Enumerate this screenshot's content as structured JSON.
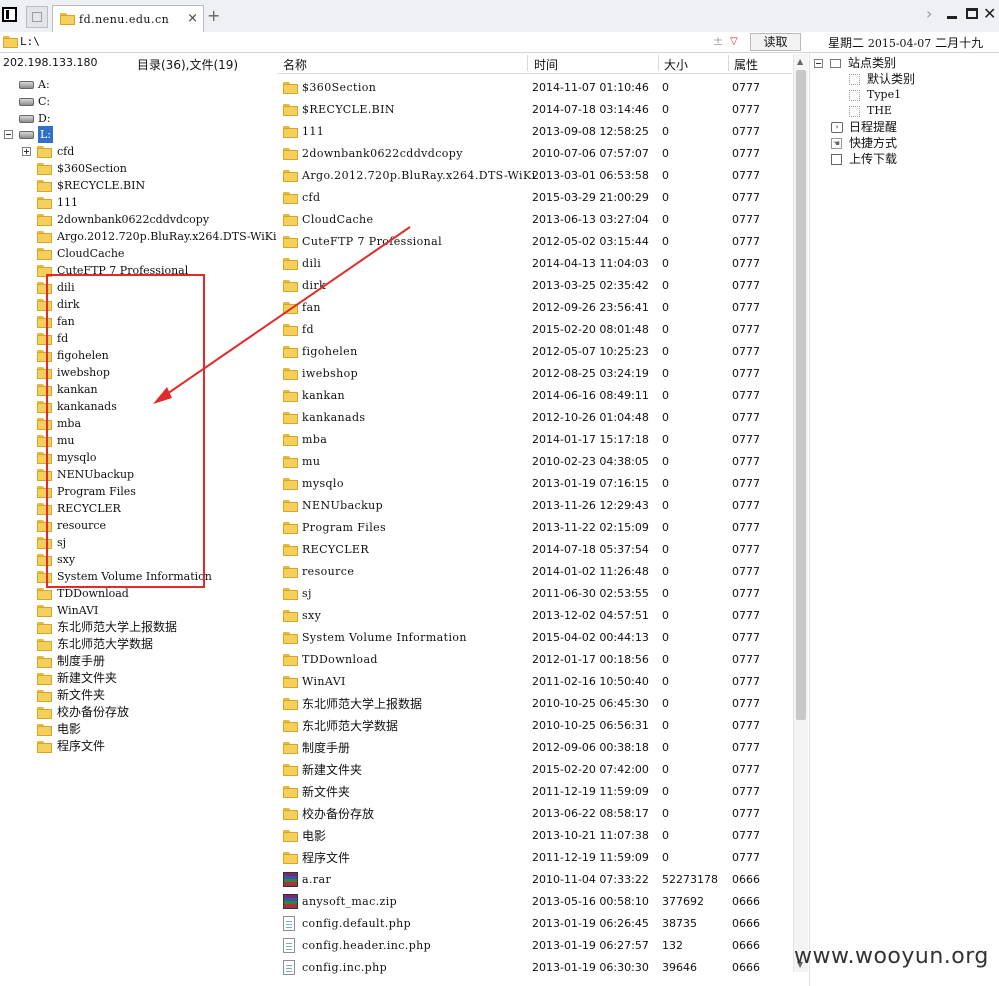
{
  "tab": {
    "title": "fd.nenu.edu.cn"
  },
  "address": {
    "path": "L:\\",
    "read_label": "读取"
  },
  "datebar": {
    "weekday": "星期二",
    "date": "2015-04-07",
    "lunar": "二月十九"
  },
  "left": {
    "ip": "202.198.133.180",
    "count": "目录(36),文件(19)",
    "drives": [
      "A:",
      "C:",
      "D:",
      "L:"
    ],
    "folders": [
      "cfd",
      "$360Section",
      "$RECYCLE.BIN",
      "111",
      "2downbank0622cddvdcopy",
      "Argo.2012.720p.BluRay.x264.DTS-WiKi",
      "CloudCache",
      "CuteFTP 7 Professional",
      "dili",
      "dirk",
      "fan",
      "fd",
      "figohelen",
      "iwebshop",
      "kankan",
      "kankanads",
      "mba",
      "mu",
      "mysqlo",
      "NENUbackup",
      "Program Files",
      "RECYCLER",
      "resource",
      "sj",
      "sxy",
      "System Volume Information",
      "TDDownload",
      "WinAVI",
      "东北师范大学上报数据",
      "东北师范大学数据",
      "制度手册",
      "新建文件夹",
      "新文件夹",
      "校办备份存放",
      "电影",
      "程序文件"
    ]
  },
  "list": {
    "headers": {
      "name": "名称",
      "time": "时间",
      "size": "大小",
      "attr": "属性"
    },
    "rows": [
      {
        "name": "$360Section",
        "time": "2014-11-07 01:10:46",
        "size": "0",
        "attr": "0777",
        "type": "folder"
      },
      {
        "name": "$RECYCLE.BIN",
        "time": "2014-07-18 03:14:46",
        "size": "0",
        "attr": "0777",
        "type": "folder"
      },
      {
        "name": "111",
        "time": "2013-09-08 12:58:25",
        "size": "0",
        "attr": "0777",
        "type": "folder"
      },
      {
        "name": "2downbank0622cddvdcopy",
        "time": "2010-07-06 07:57:07",
        "size": "0",
        "attr": "0777",
        "type": "folder"
      },
      {
        "name": "Argo.2012.720p.BluRay.x264.DTS-WiKi",
        "time": "2013-03-01 06:53:58",
        "size": "0",
        "attr": "0777",
        "type": "folder"
      },
      {
        "name": "cfd",
        "time": "2015-03-29 21:00:29",
        "size": "0",
        "attr": "0777",
        "type": "folder"
      },
      {
        "name": "CloudCache",
        "time": "2013-06-13 03:27:04",
        "size": "0",
        "attr": "0777",
        "type": "folder"
      },
      {
        "name": "CuteFTP 7 Professional",
        "time": "2012-05-02 03:15:44",
        "size": "0",
        "attr": "0777",
        "type": "folder"
      },
      {
        "name": "dili",
        "time": "2014-04-13 11:04:03",
        "size": "0",
        "attr": "0777",
        "type": "folder"
      },
      {
        "name": "dirk",
        "time": "2013-03-25 02:35:42",
        "size": "0",
        "attr": "0777",
        "type": "folder"
      },
      {
        "name": "fan",
        "time": "2012-09-26 23:56:41",
        "size": "0",
        "attr": "0777",
        "type": "folder"
      },
      {
        "name": "fd",
        "time": "2015-02-20 08:01:48",
        "size": "0",
        "attr": "0777",
        "type": "folder"
      },
      {
        "name": "figohelen",
        "time": "2012-05-07 10:25:23",
        "size": "0",
        "attr": "0777",
        "type": "folder"
      },
      {
        "name": "iwebshop",
        "time": "2012-08-25 03:24:19",
        "size": "0",
        "attr": "0777",
        "type": "folder"
      },
      {
        "name": "kankan",
        "time": "2014-06-16 08:49:11",
        "size": "0",
        "attr": "0777",
        "type": "folder"
      },
      {
        "name": "kankanads",
        "time": "2012-10-26 01:04:48",
        "size": "0",
        "attr": "0777",
        "type": "folder"
      },
      {
        "name": "mba",
        "time": "2014-01-17 15:17:18",
        "size": "0",
        "attr": "0777",
        "type": "folder"
      },
      {
        "name": "mu",
        "time": "2010-02-23 04:38:05",
        "size": "0",
        "attr": "0777",
        "type": "folder"
      },
      {
        "name": "mysqlo",
        "time": "2013-01-19 07:16:15",
        "size": "0",
        "attr": "0777",
        "type": "folder"
      },
      {
        "name": "NENUbackup",
        "time": "2013-11-26 12:29:43",
        "size": "0",
        "attr": "0777",
        "type": "folder"
      },
      {
        "name": "Program Files",
        "time": "2013-11-22 02:15:09",
        "size": "0",
        "attr": "0777",
        "type": "folder"
      },
      {
        "name": "RECYCLER",
        "time": "2014-07-18 05:37:54",
        "size": "0",
        "attr": "0777",
        "type": "folder"
      },
      {
        "name": "resource",
        "time": "2014-01-02 11:26:48",
        "size": "0",
        "attr": "0777",
        "type": "folder"
      },
      {
        "name": "sj",
        "time": "2011-06-30 02:53:55",
        "size": "0",
        "attr": "0777",
        "type": "folder"
      },
      {
        "name": "sxy",
        "time": "2013-12-02 04:57:51",
        "size": "0",
        "attr": "0777",
        "type": "folder"
      },
      {
        "name": "System Volume Information",
        "time": "2015-04-02 00:44:13",
        "size": "0",
        "attr": "0777",
        "type": "folder"
      },
      {
        "name": "TDDownload",
        "time": "2012-01-17 00:18:56",
        "size": "0",
        "attr": "0777",
        "type": "folder"
      },
      {
        "name": "WinAVI",
        "time": "2011-02-16 10:50:40",
        "size": "0",
        "attr": "0777",
        "type": "folder"
      },
      {
        "name": "东北师范大学上报数据",
        "time": "2010-10-25 06:45:30",
        "size": "0",
        "attr": "0777",
        "type": "folder"
      },
      {
        "name": "东北师范大学数据",
        "time": "2010-10-25 06:56:31",
        "size": "0",
        "attr": "0777",
        "type": "folder"
      },
      {
        "name": "制度手册",
        "time": "2012-09-06 00:38:18",
        "size": "0",
        "attr": "0777",
        "type": "folder"
      },
      {
        "name": "新建文件夹",
        "time": "2015-02-20 07:42:00",
        "size": "0",
        "attr": "0777",
        "type": "folder"
      },
      {
        "name": "新文件夹",
        "time": "2011-12-19 11:59:09",
        "size": "0",
        "attr": "0777",
        "type": "folder"
      },
      {
        "name": "校办备份存放",
        "time": "2013-06-22 08:58:17",
        "size": "0",
        "attr": "0777",
        "type": "folder"
      },
      {
        "name": "电影",
        "time": "2013-10-21 11:07:38",
        "size": "0",
        "attr": "0777",
        "type": "folder"
      },
      {
        "name": "程序文件",
        "time": "2011-12-19 11:59:09",
        "size": "0",
        "attr": "0777",
        "type": "folder"
      },
      {
        "name": "a.rar",
        "time": "2010-11-04 07:33:22",
        "size": "52273178",
        "attr": "0666",
        "type": "archive"
      },
      {
        "name": "anysoft_mac.zip",
        "time": "2013-05-16 00:58:10",
        "size": "377692",
        "attr": "0666",
        "type": "archive"
      },
      {
        "name": "config.default.php",
        "time": "2013-01-19 06:26:45",
        "size": "38735",
        "attr": "0666",
        "type": "file"
      },
      {
        "name": "config.header.inc.php",
        "time": "2013-01-19 06:27:57",
        "size": "132",
        "attr": "0666",
        "type": "file"
      },
      {
        "name": "config.inc.php",
        "time": "2013-01-19 06:30:30",
        "size": "39646",
        "attr": "0666",
        "type": "file"
      }
    ]
  },
  "sidetree": {
    "site_category": "站点类别",
    "default_category": "默认类别",
    "type1": "Type1",
    "the": "THE",
    "reminder": "日程提醒",
    "shortcut": "快捷方式",
    "upload_download": "上传下载"
  },
  "watermark": "www.wooyun.org",
  "colors": {
    "highlight_box": "#e12b2b",
    "folder": "#f4cf5a",
    "selected": "#3170c6"
  }
}
